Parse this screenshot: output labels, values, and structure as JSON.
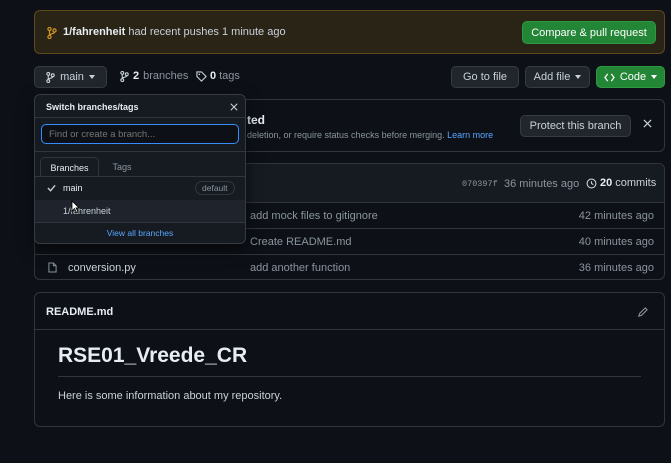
{
  "banner": {
    "branch": "1/fahrenheit",
    "message": "had recent pushes 1 minute ago",
    "button": "Compare & pull request"
  },
  "toolbar": {
    "branch_button": "main",
    "branches_count": "2",
    "branches_label": "branches",
    "tags_count": "0",
    "tags_label": "tags",
    "goto_file": "Go to file",
    "add_file": "Add file",
    "code": "Code"
  },
  "protect": {
    "title_fragment": "ted",
    "text": "deletion, or require status checks before merging.",
    "learn_more": "Learn more",
    "button": "Protect this branch"
  },
  "commit_bar": {
    "hash": "070397f",
    "time": "36 minutes ago",
    "commits_count": "20",
    "commits_label": "commits"
  },
  "files": [
    {
      "name": "",
      "message": "add mock files to gitignore",
      "time": "42 minutes ago"
    },
    {
      "name": "",
      "message": "Create README.md",
      "time": "40 minutes ago"
    },
    {
      "name": "conversion.py",
      "message": "add another function",
      "time": "36 minutes ago"
    }
  ],
  "dropdown": {
    "title": "Switch branches/tags",
    "filter_placeholder": "Find or create a branch...",
    "tabs": [
      "Branches",
      "Tags"
    ],
    "branches": [
      {
        "name": "main",
        "badge": "default"
      },
      {
        "name": "1/fahrenheit"
      }
    ],
    "view_all": "View all branches"
  },
  "readme": {
    "filename": "README.md",
    "heading": "RSE01_Vreede_CR",
    "body": "Here is some information about my repository."
  },
  "colors": {
    "accent_green": "#238636",
    "link_blue": "#58a6ff",
    "banner_bg": "#2a2416",
    "banner_border": "#5b4a1c"
  }
}
